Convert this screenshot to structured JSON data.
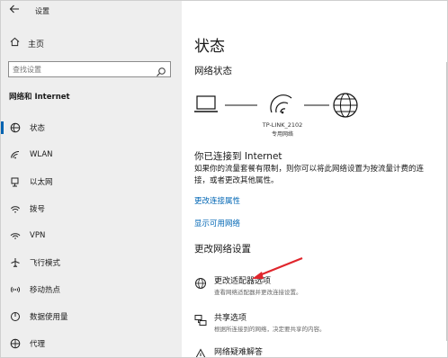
{
  "window": {
    "title": "设置",
    "controls": [
      "—",
      "☐",
      "✕"
    ]
  },
  "sidebar": {
    "home_label": "主页",
    "search_placeholder": "查找设置",
    "section_title": "网络和 Internet",
    "items": [
      {
        "label": "状态",
        "icon": "status-globe-icon",
        "active": true
      },
      {
        "label": "WLAN",
        "icon": "wifi-icon"
      },
      {
        "label": "以太网",
        "icon": "ethernet-icon"
      },
      {
        "label": "拨号",
        "icon": "dialup-icon"
      },
      {
        "label": "VPN",
        "icon": "vpn-icon"
      },
      {
        "label": "飞行模式",
        "icon": "airplane-icon"
      },
      {
        "label": "移动热点",
        "icon": "hotspot-icon"
      },
      {
        "label": "数据使用量",
        "icon": "data-usage-icon"
      },
      {
        "label": "代理",
        "icon": "proxy-globe-icon"
      }
    ]
  },
  "main": {
    "title": "状态",
    "network_status_heading": "网络状态",
    "network_name": "TP-LINK_2102",
    "network_type": "专用网络",
    "connected_title": "你已连接到 Internet",
    "connected_desc": "如果你的流量套餐有限制，则你可以将此网络设置为按流量计费的连接，或者更改其他属性。",
    "link_change_props": "更改连接属性",
    "link_show_networks": "显示可用网络",
    "change_settings_heading": "更改网络设置",
    "options": [
      {
        "title": "更改适配器选项",
        "desc": "查看网络适配器并更改连接设置。",
        "icon": "adapter-globe-icon"
      },
      {
        "title": "共享选项",
        "desc": "根据所连接到的网络，决定要共享的内容。",
        "icon": "sharing-icon"
      },
      {
        "title": "网络疑难解答",
        "desc": "",
        "icon": "warning-triangle-icon"
      }
    ]
  },
  "colors": {
    "accent": "#0063b1",
    "link": "#0066b4",
    "sidebar_bg": "#eeeeee",
    "annotation_arrow": "#e0262d"
  }
}
